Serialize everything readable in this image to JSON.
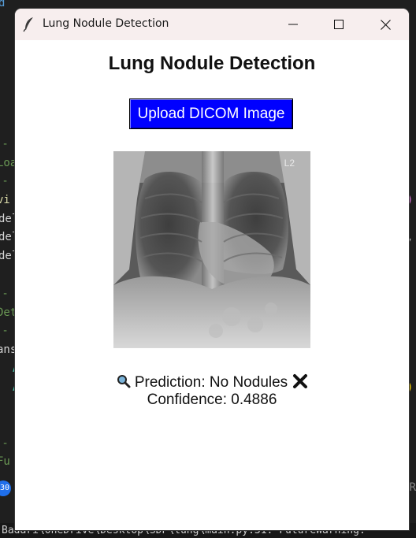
{
  "window": {
    "title": "Lung Nodule Detection"
  },
  "app": {
    "heading": "Lung Nodule Detection",
    "upload_button_label": "Upload DICOM Image",
    "image_marker": "L2",
    "prediction_label": "Prediction:",
    "prediction_value": "No Nodules",
    "confidence_text": "Confidence: 0.4886"
  },
  "background_editor": {
    "status_line": "Badari\\OneDrive\\Desktop\\SDP\\lung\\main.py:31: FutureWarning:",
    "badge_count": "30",
    "right_fragment": "DR"
  },
  "colors": {
    "button_bg": "#0000ff",
    "button_text": "#ffffff",
    "window_bg": "#ffffff",
    "titlebar_bg": "#f7eeee",
    "editor_bg": "#1f1f1f"
  },
  "icons": {
    "title": "feather-icon",
    "prediction": "magnifier-icon",
    "result": "cross-mark-icon"
  }
}
